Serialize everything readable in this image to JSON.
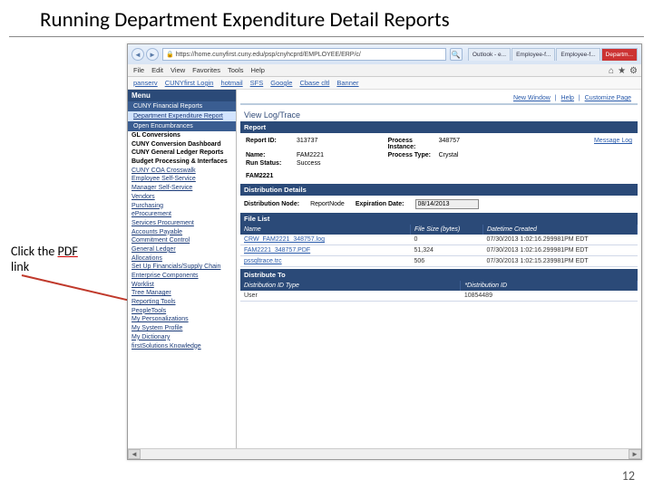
{
  "slide_title": "Running Department Expenditure Detail Reports",
  "annotation": {
    "pre": "Click the ",
    "pdf": "PDF",
    "post": " link"
  },
  "page_number": "12",
  "ie": {
    "url": "https://home.cunyfirst.cuny.edu/psp/cnyhcprd/EMPLOYEE/ERP/c/",
    "menu": [
      "File",
      "Edit",
      "View",
      "Favorites",
      "Tools",
      "Help"
    ],
    "fav": [
      "panserv",
      "CUNYfirst Login",
      "hotmail",
      "SFS",
      "Google",
      "Cbase cltl",
      "Banner"
    ],
    "tabs": [
      "Outlook - e...",
      "Employee-f...",
      "Employee-f...",
      "Departm..."
    ]
  },
  "sidebar": {
    "header": "Menu",
    "group1_title": "CUNY Financial Reports",
    "group1_items": [
      "Department Expenditure Report",
      "Open Encumbrances"
    ],
    "items": [
      "GL Conversions",
      "CUNY Conversion Dashboard",
      "CUNY General Ledger Reports",
      "Budget Processing & Interfaces",
      "CUNY COA Crosswalk",
      "Employee Self-Service",
      "Manager Self-Service",
      "Vendors",
      "Purchasing",
      "eProcurement",
      "Services Procurement",
      "Accounts Payable",
      "Commitment Control",
      "General Ledger",
      "Allocations",
      "Set Up Financials/Supply Chain",
      "Enterprise Components",
      "Worklist",
      "Tree Manager",
      "Reporting Tools",
      "PeopleTools",
      "My Personalizations",
      "My System Profile",
      "My Dictionary",
      "firstSolutions Knowledge"
    ]
  },
  "top_links": [
    "New Window",
    "Help",
    "Customize Page"
  ],
  "view_title": "View Log/Trace",
  "report": {
    "section": "Report",
    "id_label": "Report ID:",
    "id_value": "313737",
    "pi_label": "Process Instance:",
    "pi_value": "348757",
    "msglog": "Message Log",
    "name_label": "Name:",
    "name_value": "FAM2221",
    "ptype_label": "Process Type:",
    "ptype_value": "Crystal",
    "status_label": "Run Status:",
    "status_value": "Success",
    "sub_value": "FAM2221"
  },
  "dist": {
    "section": "Distribution Details",
    "node_label": "Distribution Node:",
    "node_value": "ReportNode",
    "exp_label": "Expiration Date:",
    "exp_value": "08/14/2013"
  },
  "filelist": {
    "section": "File List",
    "cols": [
      "Name",
      "File Size (bytes)",
      "Datetime Created"
    ],
    "rows": [
      {
        "name": "CRW_FAM2221_348757.log",
        "size": "0",
        "dt": "07/30/2013 1:02:16.299981PM EDT"
      },
      {
        "name": "FAM2221_348757.PDF",
        "size": "51,324",
        "dt": "07/30/2013 1:02:16.299981PM EDT"
      },
      {
        "name": "pssqltrace.trc",
        "size": "506",
        "dt": "07/30/2013 1:02:15.239981PM EDT"
      }
    ]
  },
  "distto": {
    "section": "Distribute To",
    "cols": [
      "Distribution ID Type",
      "*Distribution ID"
    ],
    "rows": [
      {
        "type": "User",
        "id": "10854489"
      }
    ]
  }
}
